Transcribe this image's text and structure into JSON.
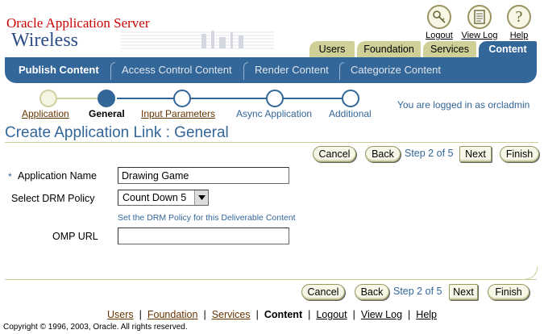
{
  "brand": {
    "company": "Oracle Application Server",
    "product": "Wireless"
  },
  "global_links": [
    {
      "label": "Logout",
      "icon": "key-icon"
    },
    {
      "label": "View Log",
      "icon": "document-icon"
    },
    {
      "label": "Help",
      "icon": "help-icon"
    }
  ],
  "tabs": [
    {
      "label": "Users",
      "active": false
    },
    {
      "label": "Foundation",
      "active": false
    },
    {
      "label": "Services",
      "active": false
    },
    {
      "label": "Content",
      "active": true
    }
  ],
  "subtabs": [
    {
      "label": "Publish Content",
      "active": true
    },
    {
      "label": "Access Control Content",
      "active": false
    },
    {
      "label": "Render Content",
      "active": false
    },
    {
      "label": "Categorize Content",
      "active": false
    }
  ],
  "train": {
    "steps": [
      {
        "label": "Application",
        "state": "visited"
      },
      {
        "label": "General",
        "state": "current"
      },
      {
        "label": "Input Parameters",
        "state": "next"
      },
      {
        "label": "Async Application",
        "state": "future"
      },
      {
        "label": "Additional",
        "state": "future"
      }
    ]
  },
  "user_status": "You are logged in as orcladmin",
  "page": {
    "title": "Create Application Link : General"
  },
  "nav": {
    "cancel": "Cancel",
    "back": "Back",
    "step": "Step 2 of 5",
    "next": "Next",
    "finish": "Finish"
  },
  "form": {
    "app_name": {
      "required_marker": "*",
      "label": "Application Name",
      "value": "Drawing Game"
    },
    "drm_policy": {
      "label": "Select DRM Policy",
      "value": "Count Down 5",
      "hint": "Set the DRM Policy for this Deliverable Content"
    },
    "omp_url": {
      "label": "OMP URL",
      "value": ""
    }
  },
  "footer": {
    "links": [
      {
        "label": "Users"
      },
      {
        "label": "Foundation"
      },
      {
        "label": "Services"
      },
      {
        "label": "Content"
      },
      {
        "label": "Logout"
      },
      {
        "label": "View Log"
      },
      {
        "label": "Help"
      }
    ],
    "copyright": "Copyright © 1996, 2003, Oracle. All rights reserved."
  },
  "colors": {
    "brand_red": "#cc0000",
    "accent_blue": "#336699",
    "tab_tan": "#cfd098",
    "link_brown": "#663300"
  }
}
